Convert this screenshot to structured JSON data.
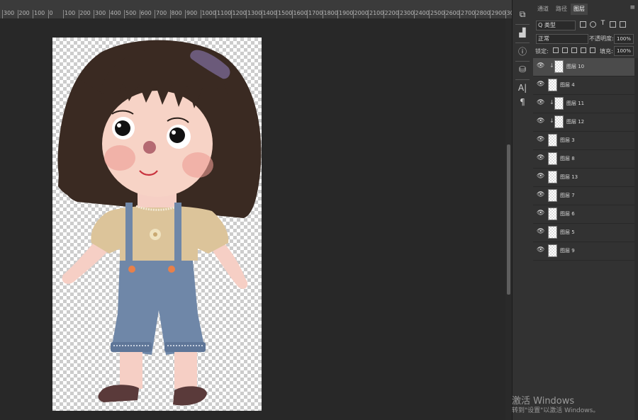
{
  "ruler": {
    "labels": [
      "300",
      "200",
      "100",
      "0",
      "100",
      "200",
      "300",
      "400",
      "500",
      "600",
      "700",
      "800",
      "900",
      "1000",
      "1100",
      "1200",
      "1300",
      "1400",
      "1500",
      "1600",
      "1700",
      "1800",
      "1900",
      "2000",
      "2100",
      "2200",
      "2300",
      "2400",
      "2500",
      "2600",
      "2700",
      "2800",
      "2900",
      "30"
    ]
  },
  "panel": {
    "tabs": [
      "通道",
      "路径",
      "图层"
    ],
    "active_tab": "图层",
    "menu_icon": "≡",
    "filter": {
      "select": "Q 类型",
      "icons": [
        "image-filter-icon",
        "adjustment-filter-icon",
        "type-filter-icon",
        "shape-filter-icon",
        "smart-object-filter-icon"
      ]
    },
    "blend_mode": "正常",
    "opacity_label": "不透明度:",
    "opacity_value": "100%",
    "lock_label": "锁定:",
    "fill_label": "填充:",
    "fill_value": "100%",
    "layers": [
      {
        "name": "图层 10",
        "clipped": true,
        "selected": true
      },
      {
        "name": "图层 4",
        "clipped": false,
        "selected": false
      },
      {
        "name": "图层 11",
        "clipped": true,
        "selected": false
      },
      {
        "name": "图层 12",
        "clipped": true,
        "selected": false
      },
      {
        "name": "图层 3",
        "clipped": false,
        "selected": false
      },
      {
        "name": "图层 8",
        "clipped": false,
        "selected": false
      },
      {
        "name": "图层 13",
        "clipped": false,
        "selected": false
      },
      {
        "name": "图层 7",
        "clipped": false,
        "selected": false
      },
      {
        "name": "图层 6",
        "clipped": false,
        "selected": false
      },
      {
        "name": "图层 5",
        "clipped": false,
        "selected": false
      },
      {
        "name": "图层 9",
        "clipped": false,
        "selected": false
      }
    ]
  },
  "toolstrip": {
    "icons": [
      "history-icon",
      "histogram-icon",
      "info-icon",
      "clone-source-icon",
      "character-icon",
      "paragraph-icon"
    ],
    "glyphs": [
      "⧉",
      "▟",
      "ⓘ",
      "⛁",
      "A|",
      "¶"
    ]
  },
  "watermark": {
    "line1": "激活 Windows",
    "line2": "转到\"设置\"以激活 Windows。"
  }
}
